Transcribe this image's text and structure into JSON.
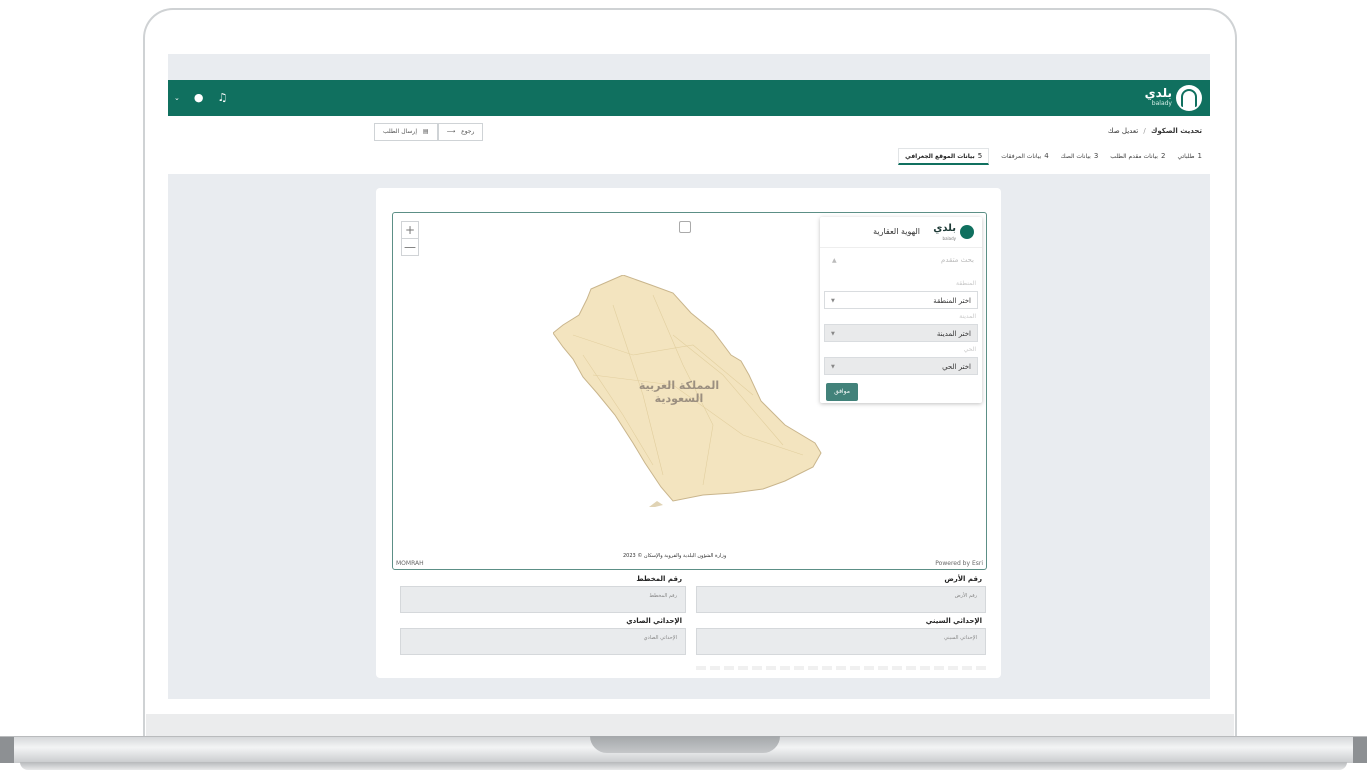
{
  "header": {
    "logo_text": "بلدي",
    "logo_sub": "balady",
    "bell_icon": "bell-icon",
    "user_icon": "user-icon",
    "chevron_icon": "chevron-down-icon",
    "brand_color": "#10705f"
  },
  "breadcrumb": {
    "section": "تحديث الصكوك",
    "page": "تعديل صك",
    "separator": "/"
  },
  "actions": {
    "back_label": "رجوع",
    "submit_label": "إرسال الطلب"
  },
  "steps": [
    {
      "num": "1",
      "label": "طلباتي"
    },
    {
      "num": "2",
      "label": "بيانات مقدم الطلب"
    },
    {
      "num": "3",
      "label": "بيانات الصك"
    },
    {
      "num": "4",
      "label": "بيانات المرفقات"
    },
    {
      "num": "5",
      "label": "بيانات الموقع الجغرافي"
    }
  ],
  "active_step": "5",
  "map": {
    "zoom_in": "+",
    "zoom_out": "—",
    "country_label_line1": "المملكة العربية",
    "country_label_line2": "السعودية",
    "credit_left": "MOMRAH",
    "credit_center": "وزارة الشؤون البلدية والقروية والإسكان © 2023",
    "credit_right": "Powered by Esri"
  },
  "search_panel": {
    "logo_text": "بلدي",
    "logo_sub": "balady",
    "title": "الهوية العقارية",
    "advanced_search": "بحث متقدم",
    "region_label": "المنطقة",
    "region_value": "اختر المنطقة",
    "city_label": "المدينة",
    "city_value": "اختر المدينة",
    "district_label": "الحي",
    "district_value": "اختر الحي",
    "ok_label": "موافق"
  },
  "fields": {
    "land_number": {
      "label": "رقم الأرض",
      "placeholder": "رقم الأرض"
    },
    "plan_number": {
      "label": "رقم المخطط",
      "placeholder": "رقم المخطط"
    },
    "x_coord": {
      "label": "الإحداثي السيني",
      "placeholder": "الإحداثي السيني"
    },
    "y_coord": {
      "label": "الإحداثي الصادي",
      "placeholder": "الإحداثي الصادي"
    }
  }
}
